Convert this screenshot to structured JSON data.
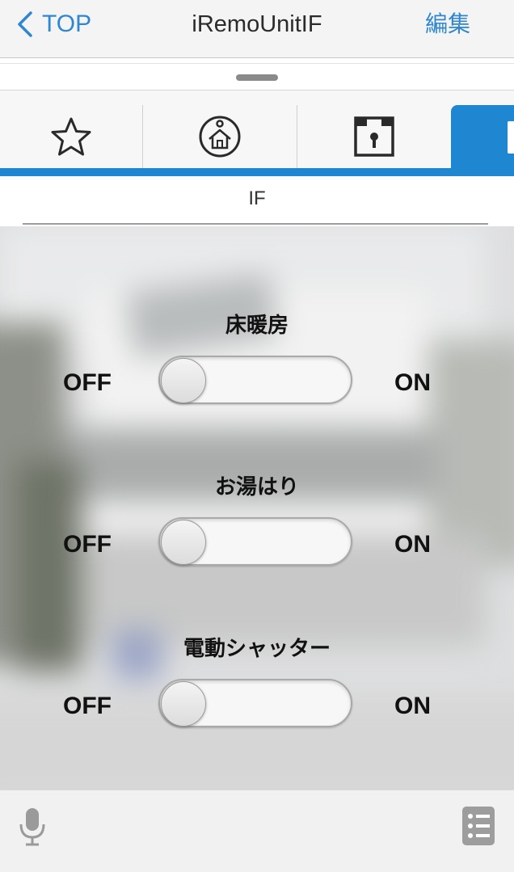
{
  "navbar": {
    "back_label": "TOP",
    "title": "iRemoUnitIF",
    "edit_label": "編集"
  },
  "tabs": {
    "items": [
      {
        "icon": "star-icon"
      },
      {
        "icon": "home-icon"
      },
      {
        "icon": "lock-box-icon"
      },
      {
        "icon": "remote-icon",
        "active": true
      }
    ],
    "accent_color": "#1f86d2"
  },
  "subtitle": "IF",
  "controls": [
    {
      "label": "床暖房",
      "off_label": "OFF",
      "on_label": "ON",
      "state": "off"
    },
    {
      "label": "お湯はり",
      "off_label": "OFF",
      "on_label": "ON",
      "state": "off"
    },
    {
      "label": "電動シャッター",
      "off_label": "OFF",
      "on_label": "ON",
      "state": "off"
    }
  ],
  "bottombar": {
    "left_icon": "microphone-icon",
    "right_icon": "list-icon"
  }
}
